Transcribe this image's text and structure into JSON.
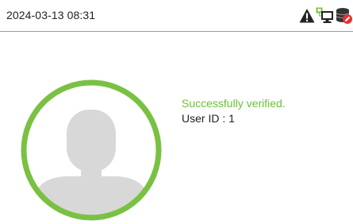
{
  "status_bar": {
    "datetime": "2024-03-13 08:31",
    "icons": [
      "warning-icon",
      "network-computer-icon",
      "server-error-icon"
    ]
  },
  "verification": {
    "message": "Successfully verified.",
    "user_id_label": "User ID",
    "user_id_separator": " : ",
    "user_id_value": "1"
  },
  "colors": {
    "success_green": "#6cbf3a",
    "ring_green": "#7ac143",
    "avatar_gray": "#d8d8d8",
    "text": "#222222",
    "error_red": "#e5322d"
  }
}
